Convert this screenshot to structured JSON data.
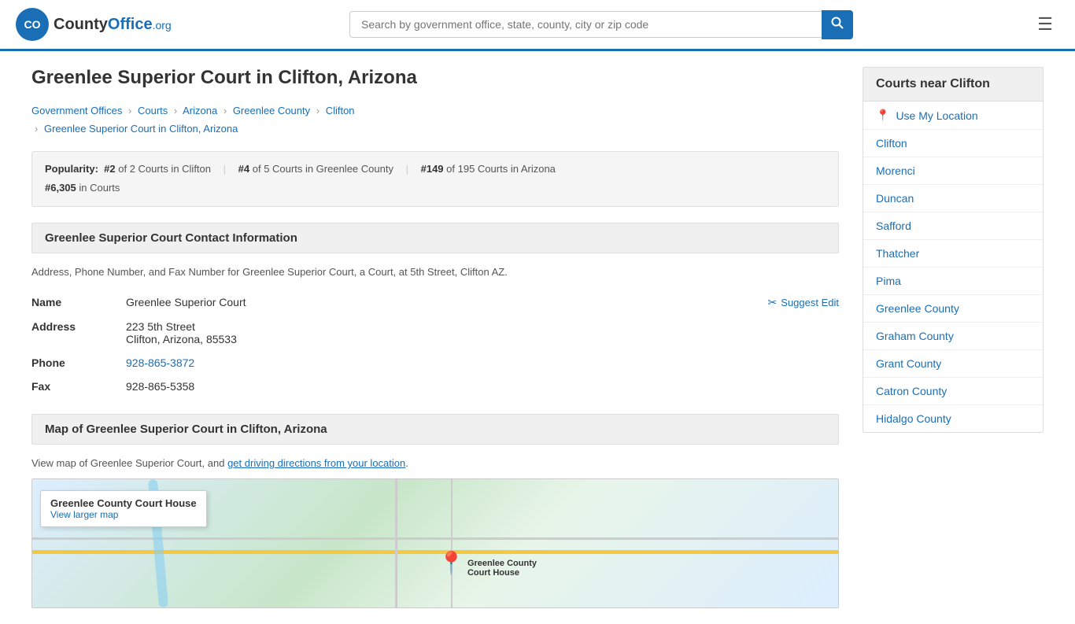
{
  "header": {
    "logo_text": "County",
    "logo_org": "Office",
    "logo_domain": ".org",
    "search_placeholder": "Search by government office, state, county, city or zip code",
    "menu_icon": "☰"
  },
  "page": {
    "title": "Greenlee Superior Court in Clifton, Arizona",
    "breadcrumb": {
      "items": [
        {
          "label": "Government Offices",
          "href": "#"
        },
        {
          "label": "Courts",
          "href": "#"
        },
        {
          "label": "Arizona",
          "href": "#"
        },
        {
          "label": "Greenlee County",
          "href": "#"
        },
        {
          "label": "Clifton",
          "href": "#"
        },
        {
          "label": "Greenlee Superior Court in Clifton, Arizona",
          "href": "#"
        }
      ]
    },
    "popularity": {
      "label": "Popularity:",
      "rank1": "#2",
      "rank1_text": "of 2 Courts in Clifton",
      "rank2": "#4",
      "rank2_text": "of 5 Courts in Greenlee County",
      "rank3": "#149",
      "rank3_text": "of 195 Courts in Arizona",
      "rank4": "#6,305",
      "rank4_text": "in Courts"
    },
    "contact_section": {
      "header": "Greenlee Superior Court Contact Information",
      "description": "Address, Phone Number, and Fax Number for Greenlee Superior Court, a Court, at 5th Street, Clifton AZ.",
      "name_label": "Name",
      "name_value": "Greenlee Superior Court",
      "address_label": "Address",
      "address_line1": "223 5th Street",
      "address_line2": "Clifton, Arizona, 85533",
      "phone_label": "Phone",
      "phone_value": "928-865-3872",
      "fax_label": "Fax",
      "fax_value": "928-865-5358",
      "suggest_edit_label": "Suggest Edit"
    },
    "map_section": {
      "header": "Map of Greenlee Superior Court in Clifton, Arizona",
      "description": "View map of Greenlee Superior Court, and",
      "driving_link": "get driving directions from your location",
      "map_infobox_title": "Greenlee County Court House",
      "map_infobox_link": "View larger map",
      "pin_emoji": "📍"
    }
  },
  "sidebar": {
    "title": "Courts near Clifton",
    "use_location_label": "Use My Location",
    "items": [
      {
        "label": "Clifton",
        "href": "#"
      },
      {
        "label": "Morenci",
        "href": "#"
      },
      {
        "label": "Duncan",
        "href": "#"
      },
      {
        "label": "Safford",
        "href": "#"
      },
      {
        "label": "Thatcher",
        "href": "#"
      },
      {
        "label": "Pima",
        "href": "#"
      },
      {
        "label": "Greenlee County",
        "href": "#"
      },
      {
        "label": "Graham County",
        "href": "#"
      },
      {
        "label": "Grant County",
        "href": "#"
      },
      {
        "label": "Catron County",
        "href": "#"
      },
      {
        "label": "Hidalgo County",
        "href": "#"
      }
    ]
  }
}
